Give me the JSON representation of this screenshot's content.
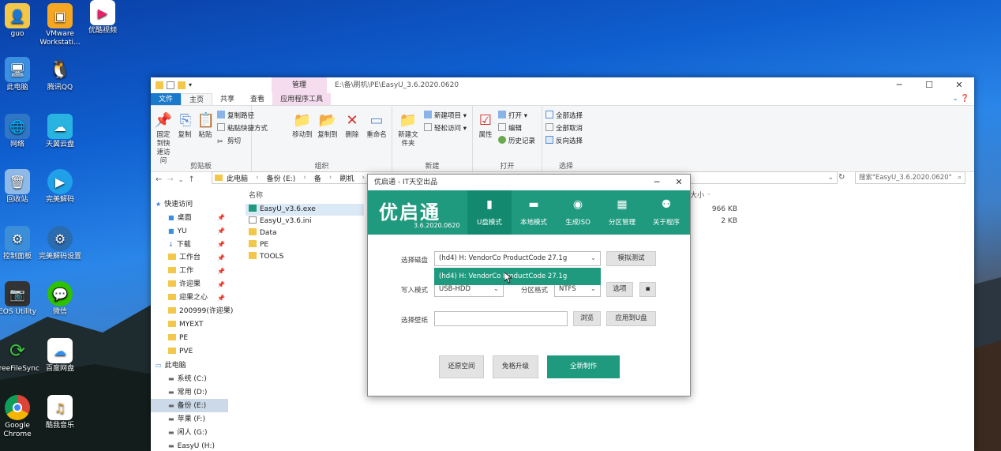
{
  "desktop": {
    "icons": [
      {
        "label": "guo",
        "icon": "user-folder-icon"
      },
      {
        "label": "VMware Workstati...",
        "icon": "vmware-icon"
      },
      {
        "label": "优酷视频",
        "icon": "youku-icon"
      },
      {
        "label": "此电脑",
        "icon": "computer-icon"
      },
      {
        "label": "腾讯QQ",
        "icon": "qq-icon"
      },
      {
        "label": "网络",
        "icon": "network-icon"
      },
      {
        "label": "天翼云盘",
        "icon": "cloud-icon"
      },
      {
        "label": "回收站",
        "icon": "recycle-bin-icon"
      },
      {
        "label": "完美解码",
        "icon": "player-icon"
      },
      {
        "label": "控制面板",
        "icon": "control-panel-icon"
      },
      {
        "label": "完美解码设置",
        "icon": "gear-icon"
      },
      {
        "label": "EOS Utility",
        "icon": "camera-icon"
      },
      {
        "label": "微信",
        "icon": "wechat-icon"
      },
      {
        "label": "FreeFileSync",
        "icon": "sync-icon"
      },
      {
        "label": "百度网盘",
        "icon": "baidu-cloud-icon"
      },
      {
        "label": "Google Chrome",
        "icon": "chrome-icon"
      },
      {
        "label": "酷我音乐",
        "icon": "kuwo-icon"
      }
    ]
  },
  "explorer": {
    "manage_tab": "管理",
    "title_path": "E:\\备\\刷机\\PE\\EasyU_3.6.2020.0620",
    "tabs": {
      "file": "文件",
      "home": "主页",
      "share": "共享",
      "view": "查看",
      "app_tools": "应用程序工具"
    },
    "ribbon": {
      "pin": "固定到快速访问",
      "copy": "复制",
      "paste": "粘贴",
      "copy_path": "复制路径",
      "paste_shortcut": "粘贴快捷方式",
      "cut": "剪切",
      "clipboard": "剪贴板",
      "move_to": "移动到",
      "copy_to": "复制到",
      "delete": "删除",
      "rename": "重命名",
      "organize": "组织",
      "new_item": "新建项目",
      "easy_access": "轻松访问",
      "new_folder": "新建文件夹",
      "new_group": "新建",
      "properties": "属性",
      "open": "打开",
      "edit": "编辑",
      "history": "历史记录",
      "open_group": "打开",
      "select_all": "全部选择",
      "select_none": "全部取消",
      "invert": "反向选择",
      "select_group": "选择"
    },
    "breadcrumb": [
      "此电脑",
      "备份 (E:)",
      "备",
      "刷机",
      "PE"
    ],
    "search_placeholder": "搜索\"EasyU_3.6.2020.0620\"",
    "nav": [
      {
        "label": "快速访问",
        "type": "star"
      },
      {
        "label": "桌面",
        "type": "desk",
        "pin": true
      },
      {
        "label": "YU",
        "type": "desk",
        "pin": true
      },
      {
        "label": "下载",
        "type": "down",
        "pin": true
      },
      {
        "label": "工作台",
        "type": "folder",
        "pin": true
      },
      {
        "label": "工作",
        "type": "folder",
        "pin": true
      },
      {
        "label": "许迎果",
        "type": "folder",
        "pin": true
      },
      {
        "label": "迎果之心",
        "type": "folder",
        "pin": true
      },
      {
        "label": "200999(许迎果)",
        "type": "folder"
      },
      {
        "label": "MYEXT",
        "type": "folder"
      },
      {
        "label": "PE",
        "type": "folder"
      },
      {
        "label": "PVE",
        "type": "folder"
      },
      {
        "label": "此电脑",
        "type": "pc"
      },
      {
        "label": "系统 (C:)",
        "type": "drive"
      },
      {
        "label": "常用 (D:)",
        "type": "drive"
      },
      {
        "label": "备份 (E:)",
        "type": "drive",
        "selected": true
      },
      {
        "label": "苹果 (F:)",
        "type": "drive"
      },
      {
        "label": "闲人 (G:)",
        "type": "drive"
      },
      {
        "label": "EasyU (H:)",
        "type": "drive"
      }
    ],
    "columns": {
      "name": "名称",
      "size": "大小"
    },
    "files": [
      {
        "name": "EasyU_v3.6.exe",
        "type": "exe",
        "size": "966 KB",
        "selected": true
      },
      {
        "name": "EasyU_v3.6.ini",
        "type": "ini",
        "size": "2 KB"
      },
      {
        "name": "Data",
        "type": "folder",
        "size": ""
      },
      {
        "name": "PE",
        "type": "folder",
        "size": ""
      },
      {
        "name": "TOOLS",
        "type": "folder",
        "size": ""
      }
    ]
  },
  "dialog": {
    "title": "优启通 - IT天空出品",
    "logo": "优启通",
    "version": "3.6.2020.0620",
    "tabs": [
      {
        "label": "U盘模式",
        "icon": "usb-icon",
        "active": true
      },
      {
        "label": "本地模式",
        "icon": "hdd-icon"
      },
      {
        "label": "生成ISO",
        "icon": "disc-icon"
      },
      {
        "label": "分区管理",
        "icon": "grid-icon"
      },
      {
        "label": "关于程序",
        "icon": "people-icon"
      }
    ],
    "select_disk_label": "选择磁盘",
    "select_disk_value": "(hd4) H: VendorCo ProductCode 27.1g",
    "dropdown_option": "(hd4) H: VendorCo ProductCode 27.1g",
    "simulate_btn": "模拟测试",
    "write_mode_label": "写入模式",
    "write_mode_value": "USB-HDD",
    "partition_label": "分区格式",
    "partition_value": "NTFS",
    "options_btn": "选项",
    "wallpaper_label": "选择壁纸",
    "wallpaper_value": "",
    "browse_btn": "浏览",
    "apply_btn": "应用到U盘",
    "restore_btn": "还原空间",
    "upgrade_btn": "免格升级",
    "create_btn": "全新制作"
  },
  "colors": {
    "accent": "#1f9a7e",
    "file_tab": "#1979ca",
    "manage": "#f6dcef"
  }
}
